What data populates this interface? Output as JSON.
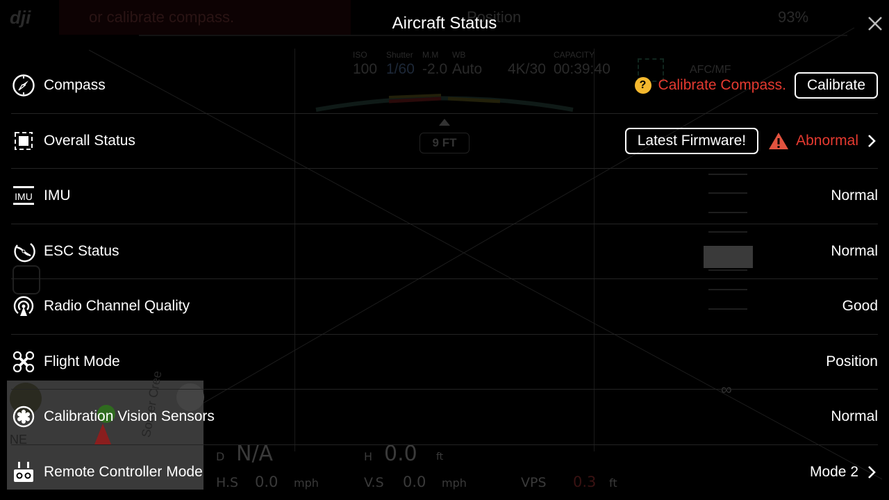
{
  "dialog": {
    "title": "Aircraft Status",
    "close_icon": "close-icon"
  },
  "rows": [
    {
      "label": "Compass",
      "icon": "compass-icon",
      "warning_text": "Calibrate Compass.",
      "warning_icon": "question-icon",
      "button_label": "Calibrate"
    },
    {
      "label": "Overall Status",
      "icon": "overall-status-icon",
      "button_label": "Latest Firmware!",
      "value": "Abnormal",
      "value_icon": "warning-triangle-icon",
      "has_chevron": true
    },
    {
      "label": "IMU",
      "icon": "imu-icon",
      "value": "Normal"
    },
    {
      "label": "ESC Status",
      "icon": "esc-propeller-icon",
      "value": "Normal"
    },
    {
      "label": "Radio Channel Quality",
      "icon": "radio-antenna-icon",
      "value": "Good"
    },
    {
      "label": "Flight Mode",
      "icon": "drone-icon",
      "value": "Position"
    },
    {
      "label": "Calibration Vision Sensors",
      "icon": "vision-sensor-icon",
      "value": "Normal"
    },
    {
      "label": "Remote Controller Mode",
      "icon": "remote-controller-icon",
      "value": "Mode 2",
      "has_chevron": true
    }
  ],
  "background_hud": {
    "top_message": "or calibrate compass.",
    "flight_mode": "Position",
    "battery": "93%",
    "camera": {
      "iso_label": "ISO",
      "iso": "100",
      "shutter_label": "Shutter",
      "shutter": "1/60",
      "mm_label": "M.M",
      "mm": "-2.0",
      "wb_label": "WB",
      "wb": "Auto",
      "resolution": "4K/30",
      "capacity_label": "CAPACITY",
      "capacity": "00:39:40",
      "focus": "AFC/MF"
    },
    "obstacle_distance": "9 FT",
    "telemetry": {
      "d_label": "D",
      "d_value": "N/A",
      "h_label": "H",
      "h_value": "0.0",
      "h_unit": "ft",
      "hs_label": "H.S",
      "hs_value": "0.0",
      "hs_unit": "mph",
      "vs_label": "V.S",
      "vs_value": "0.0",
      "vs_unit": "mph",
      "vps_label": "VPS",
      "vps_value": "0.3",
      "vps_unit": "ft"
    },
    "map": {
      "direction": "NE",
      "street": "Somer Cree"
    }
  },
  "colors": {
    "warning_red": "#e53a30",
    "question_yellow": "#f5b82e"
  }
}
